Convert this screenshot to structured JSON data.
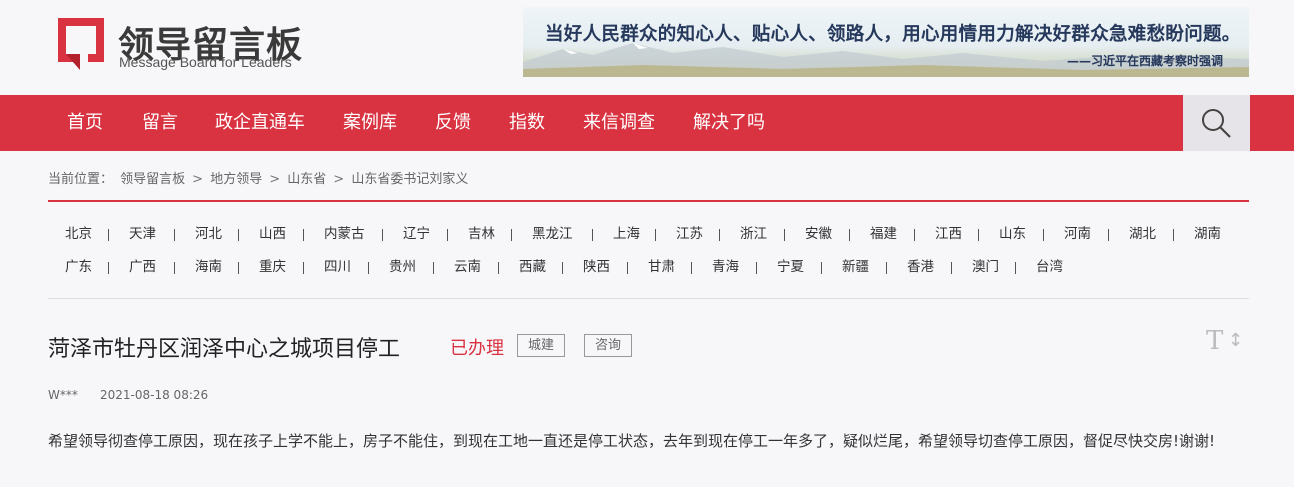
{
  "logo": {
    "title": "领导留言板",
    "subtitle": "Message Board for Leaders",
    "brand_color": "#d93341"
  },
  "banner": {
    "quote": "当好人民群众的知心人、贴心人、领路人，用心用情用力解决好群众急难愁盼问题。",
    "source": "——习近平在西藏考察时强调"
  },
  "nav": {
    "items": [
      "首页",
      "留言",
      "政企直通车",
      "案例库",
      "反馈",
      "指数",
      "来信调查",
      "解决了吗"
    ],
    "search_icon": "search-icon"
  },
  "breadcrumb": {
    "prefix": "当前位置：",
    "items": [
      "领导留言板",
      "地方领导",
      "山东省",
      "山东省委书记刘家义"
    ],
    "separator": ">"
  },
  "regions": {
    "row1": [
      "北京",
      "天津",
      "河北",
      "山西",
      "内蒙古",
      "辽宁",
      "吉林",
      "黑龙江",
      "上海",
      "江苏",
      "浙江",
      "安徽",
      "福建",
      "江西",
      "山东",
      "河南",
      "湖北",
      "湖南"
    ],
    "row2": [
      "广东",
      "广西",
      "海南",
      "重庆",
      "四川",
      "贵州",
      "云南",
      "西藏",
      "陕西",
      "甘肃",
      "青海",
      "宁夏",
      "新疆",
      "香港",
      "澳门",
      "台湾"
    ]
  },
  "article": {
    "title": "菏泽市牡丹区润泽中心之城项目停工",
    "status": "已办理",
    "tags": [
      "城建",
      "咨询"
    ],
    "font_toggle_icon": "font-size-toggle-icon",
    "author": "W***",
    "date": "2021-08-18 08:26",
    "content": "希望领导彻查停工原因，现在孩子上学不能上，房子不能住，到现在工地一直还是停工状态，去年到现在停工一年多了，疑似烂尾，希望领导切查停工原因，督促尽快交房!谢谢!"
  }
}
